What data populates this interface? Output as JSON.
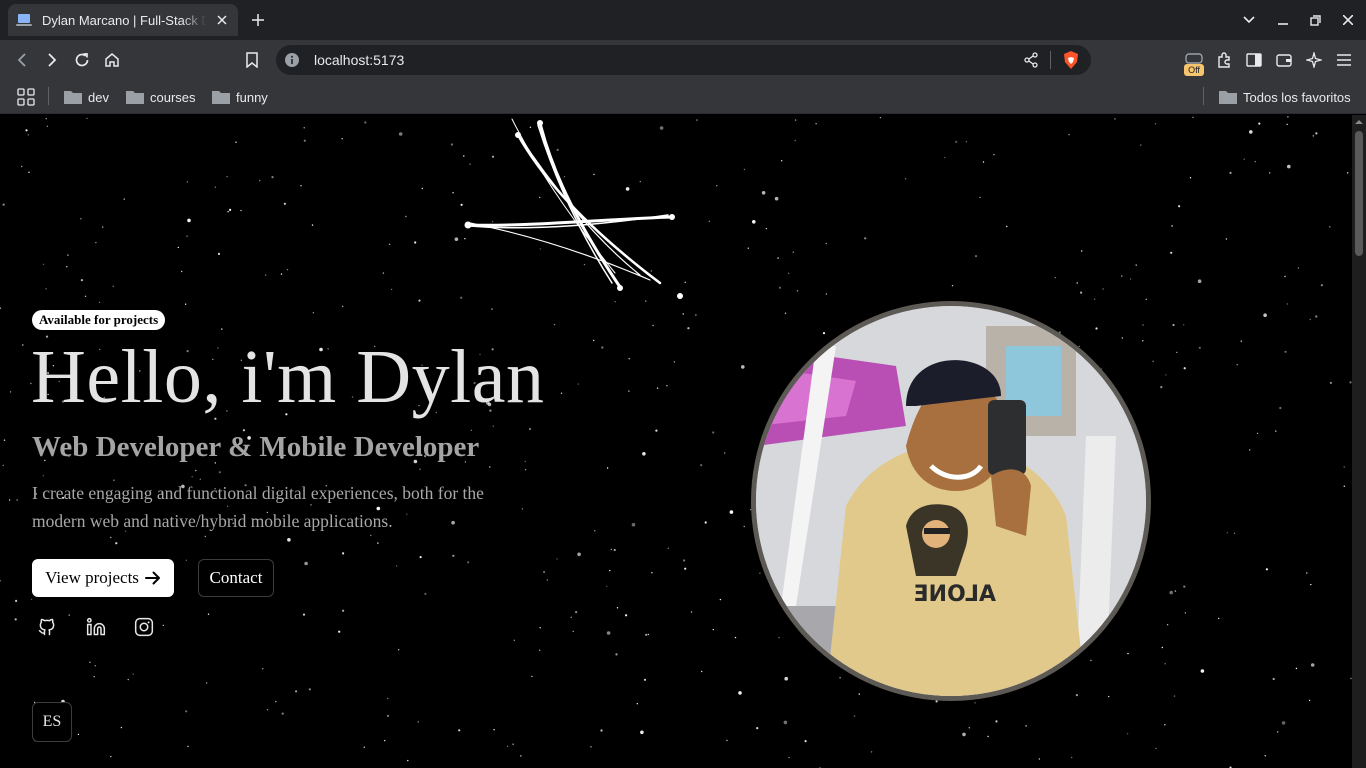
{
  "browser": {
    "tab_title": "Dylan Marcano | Full-Stack Developer",
    "url": "localhost:5173",
    "shields_badge": "Off",
    "bookmarks": [
      {
        "label": "dev"
      },
      {
        "label": "courses"
      },
      {
        "label": "funny"
      }
    ],
    "all_bookmarks_label": "Todos los favoritos"
  },
  "hero": {
    "status_badge": "Available for projects",
    "title": "Hello, i'm Dylan",
    "subtitle": "Web Developer & Mobile Developer",
    "description": "I create engaging and functional digital experiences, both for the modern web and native/hybrid mobile applications.",
    "primary_button": "View projects",
    "secondary_button": "Contact",
    "social_icons": [
      "github-icon",
      "linkedin-icon",
      "instagram-icon"
    ],
    "language_toggle": "ES"
  },
  "colors": {
    "page_background": "#000000",
    "title_text": "#e4e4e4",
    "muted_text": "#a4a4a4",
    "browser_chrome": "#35363a"
  }
}
